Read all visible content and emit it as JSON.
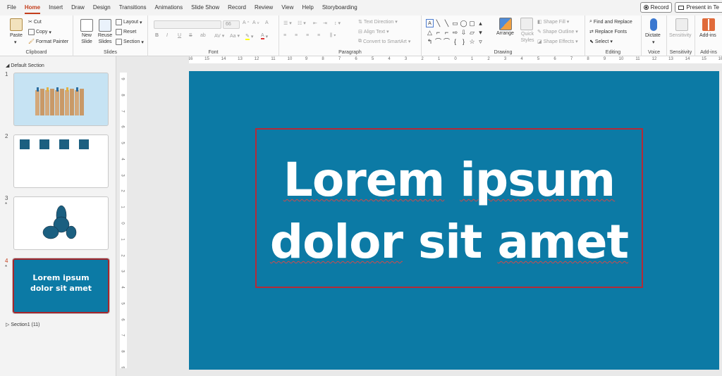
{
  "menu": {
    "tabs": [
      "File",
      "Home",
      "Insert",
      "Draw",
      "Design",
      "Transitions",
      "Animations",
      "Slide Show",
      "Record",
      "Review",
      "View",
      "Help",
      "Storyboarding"
    ],
    "active": "Home",
    "record_btn": "Record",
    "present_btn": "Present in Te"
  },
  "ribbon": {
    "clipboard": {
      "label": "Clipboard",
      "paste": "Paste",
      "cut": "Cut",
      "copy": "Copy",
      "format_painter": "Format Painter"
    },
    "slides": {
      "label": "Slides",
      "new_slide": "New Slide",
      "reuse_slides": "Reuse Slides",
      "layout": "Layout",
      "reset": "Reset",
      "section": "Section"
    },
    "font": {
      "label": "Font",
      "size": "66"
    },
    "paragraph": {
      "label": "Paragraph",
      "text_direction": "Text Direction",
      "align_text": "Align Text",
      "convert_smartart": "Convert to SmartArt"
    },
    "drawing": {
      "label": "Drawing",
      "arrange": "Arrange",
      "quick_styles": "Quick Styles",
      "shape_fill": "Shape Fill",
      "shape_outline": "Shape Outline",
      "shape_effects": "Shape Effects"
    },
    "editing": {
      "label": "Editing",
      "find_replace": "Find and Replace",
      "replace_fonts": "Replace Fonts",
      "select": "Select"
    },
    "voice": {
      "label": "Voice",
      "dictate": "Dictate"
    },
    "sensitivity": {
      "label": "Sensitivity",
      "button": "Sensitivity"
    },
    "addins": {
      "label": "Add-ins",
      "button": "Add-ins"
    }
  },
  "slides_pane": {
    "section_default": "Default Section",
    "section1": "Section1 (11)",
    "slides": [
      {
        "number": "1"
      },
      {
        "number": "2"
      },
      {
        "number": "3",
        "star": "*"
      },
      {
        "number": "4",
        "star": "*",
        "text": "Lorem ipsum dolor sit amet"
      }
    ]
  },
  "slide": {
    "line1_word1": "Lorem",
    "line1_word2": "ipsum",
    "line2_word1": "dolor",
    "line2_word2": "sit",
    "line2_word3": "amet"
  },
  "rulers": {
    "horizontal": [
      "16",
      "15",
      "14",
      "13",
      "12",
      "11",
      "10",
      "9",
      "8",
      "7",
      "6",
      "5",
      "4",
      "3",
      "2",
      "1",
      "0",
      "1",
      "2",
      "3",
      "4",
      "5",
      "6",
      "7",
      "8",
      "9",
      "10",
      "11",
      "12",
      "13",
      "14",
      "15",
      "16"
    ],
    "vertical": [
      "9",
      "8",
      "7",
      "6",
      "5",
      "4",
      "3",
      "2",
      "1",
      "0",
      "1",
      "2",
      "3",
      "4",
      "5",
      "6",
      "7",
      "8",
      "9"
    ]
  },
  "colors": {
    "accent": "#c43e1c",
    "slide_bg": "#0c7aa5",
    "selection": "#b52a37"
  }
}
